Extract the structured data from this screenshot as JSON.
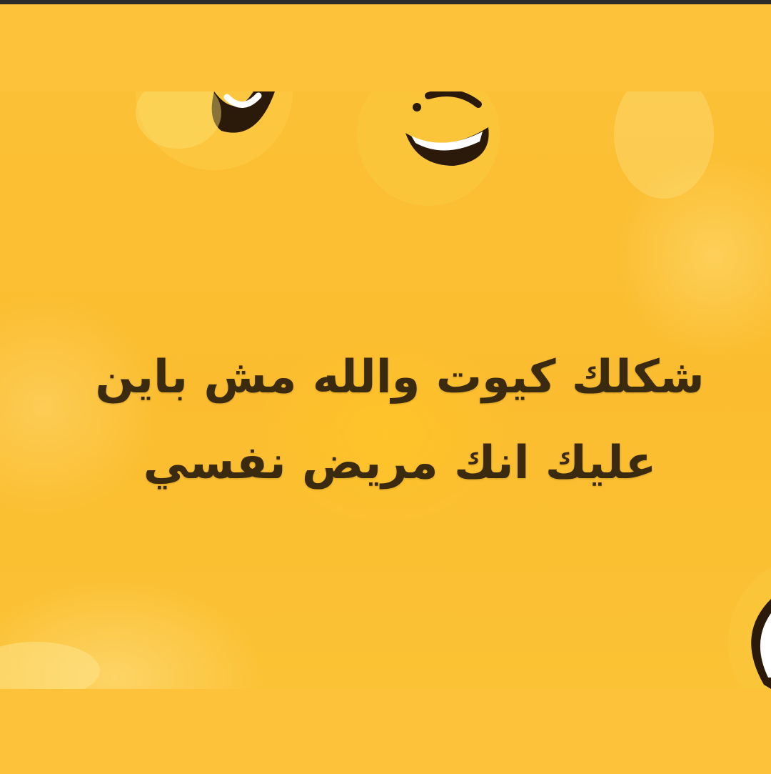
{
  "caption": {
    "line1": "شكلك كيوت والله مش باين",
    "line2": "عليك انك مريض نفسي"
  },
  "colors": {
    "background": "#fdc13a",
    "image_yellow": "#fbbd2f",
    "text": "#3a2a10"
  },
  "icons": [
    "laughing-emoji-icon",
    "laughing-emoji-icon",
    "laughing-emoji-icon"
  ]
}
